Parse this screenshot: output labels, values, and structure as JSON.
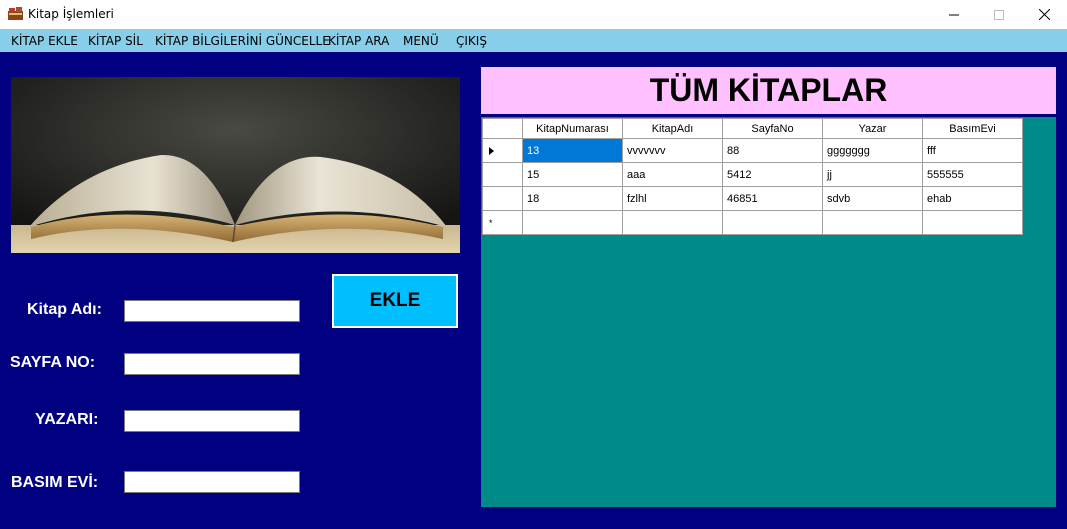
{
  "window": {
    "title": "Kitap İşlemleri",
    "app_icon": "books-icon"
  },
  "menu": [
    {
      "label": "KİTAP EKLE"
    },
    {
      "label": "KİTAP SİL"
    },
    {
      "label": "KİTAP BİLGİLERİNİ GÜNCELLE"
    },
    {
      "label": "KİTAP ARA"
    },
    {
      "label": "MENÜ"
    },
    {
      "label": "ÇIKIŞ"
    }
  ],
  "form": {
    "kitap_adi_label": "Kitap Adı:",
    "sayfa_no_label": "SAYFA NO:",
    "yazari_label": "YAZARI:",
    "basim_evi_label": "BASIM EVİ:",
    "kitap_adi_value": "",
    "sayfa_no_value": "",
    "yazari_value": "",
    "basim_evi_value": "",
    "ekle_label": "EKLE"
  },
  "grid": {
    "title": "TÜM KİTAPLAR",
    "columns": [
      "KitapNumarası",
      "KitapAdı",
      "SayfaNo",
      "Yazar",
      "BasımEvi"
    ],
    "rows": [
      [
        "13",
        "vvvvvvv",
        "88",
        "ggggggg",
        "fff"
      ],
      [
        "15",
        "aaa",
        "5412",
        "jj",
        "555555"
      ],
      [
        "18",
        "fzlhl",
        "46851",
        "sdvb",
        "ehab"
      ]
    ],
    "selected_row": 0,
    "new_row_marker": "*"
  },
  "colors": {
    "client_background": "#000080",
    "menu_background": "#87ceeb",
    "grid_background": "#008b8b",
    "title_background": "#ffc0ff",
    "button_background": "#00bfff",
    "selection": "#0078d7"
  }
}
